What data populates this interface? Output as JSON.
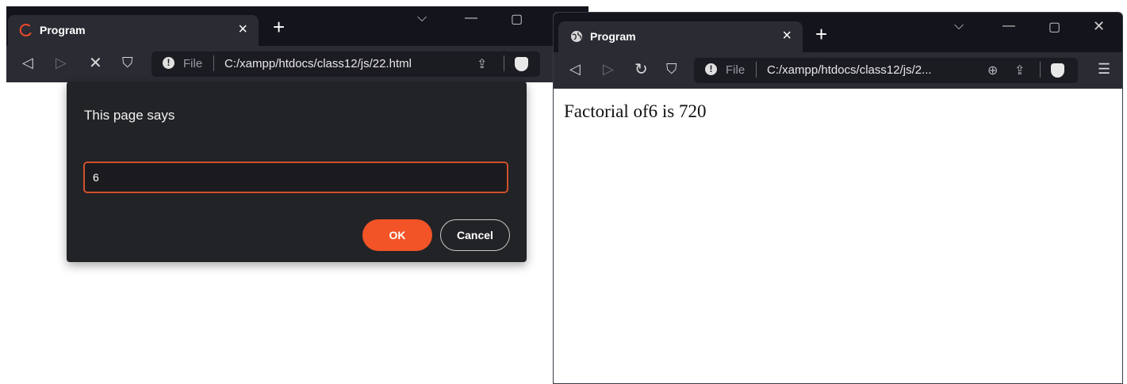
{
  "left_window": {
    "tab": {
      "title": "Program",
      "close": "×",
      "icon": "loading-spinner-icon"
    },
    "new_tab": "+",
    "caption": {
      "dropdown": "⌵",
      "minimize": "—",
      "maximize": "▢"
    },
    "toolbar": {
      "back": "◁",
      "forward": "▷",
      "stop": "✕",
      "bookmark": "⛉"
    },
    "address": {
      "info": "!",
      "scheme": "File",
      "url": "C:/xampp/htdocs/class12/js/22.html",
      "share": "⇪"
    },
    "dialog": {
      "title": "This page says",
      "input_value": "6",
      "ok_label": "OK",
      "cancel_label": "Cancel"
    }
  },
  "right_window": {
    "tab": {
      "title": "Program",
      "close": "×",
      "icon": "globe-icon"
    },
    "new_tab": "+",
    "caption": {
      "dropdown": "⌵",
      "minimize": "—",
      "maximize": "▢",
      "close": "✕"
    },
    "toolbar": {
      "back": "◁",
      "forward": "▷",
      "reload": "↻",
      "bookmark": "⛉",
      "menu": "☰"
    },
    "address": {
      "info": "!",
      "scheme": "File",
      "url": "C:/xampp/htdocs/class12/js/2...",
      "zoom": "⊕",
      "share": "⇪"
    },
    "content": {
      "result_text": "Factorial of6 is 720"
    }
  },
  "colors": {
    "accent": "#f25427",
    "frame": "#14141c",
    "toolbar": "#2a2b33",
    "dialog": "#222327"
  }
}
